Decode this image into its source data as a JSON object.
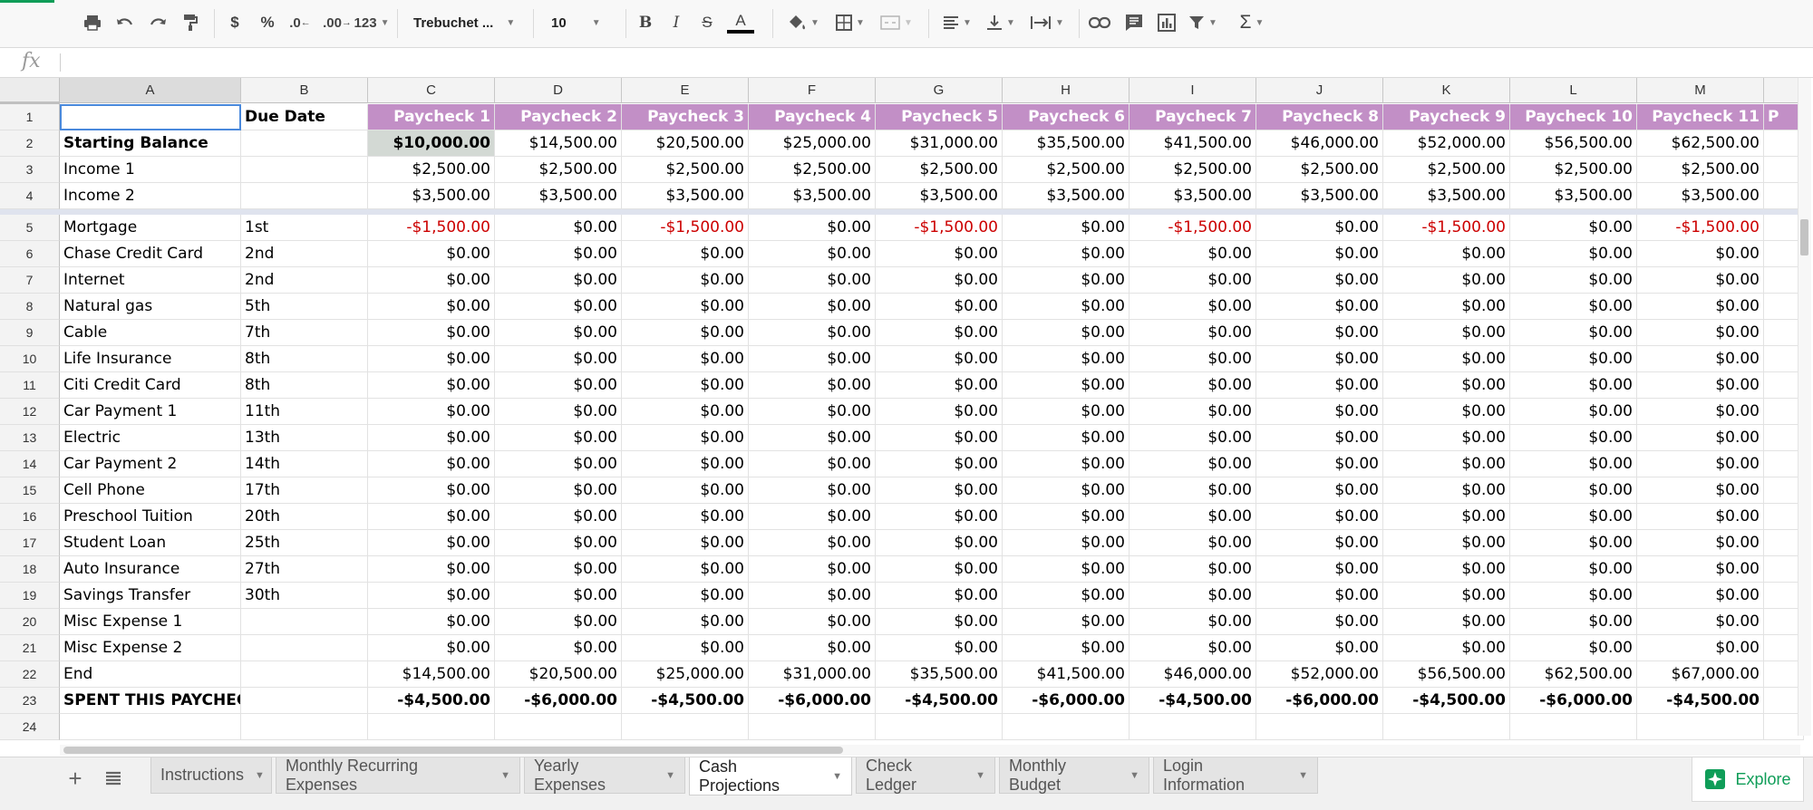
{
  "toolbar": {
    "format_123": "123",
    "font": "Trebuchet ...",
    "font_size": "10",
    "currency": "$",
    "percent": "%",
    "dec_less": ".0",
    "dec_more": ".00",
    "sigma": "Σ"
  },
  "formula_bar": {
    "fx": "fx",
    "value": ""
  },
  "columns": [
    "A",
    "B",
    "C",
    "D",
    "E",
    "F",
    "G",
    "H",
    "I",
    "J",
    "K",
    "L",
    "M"
  ],
  "rows": [
    {
      "n": "1",
      "a": "",
      "b": "Due Date",
      "v": [
        "Paycheck 1",
        "Paycheck 2",
        "Paycheck 3",
        "Paycheck 4",
        "Paycheck 5",
        "Paycheck 6",
        "Paycheck 7",
        "Paycheck 8",
        "Paycheck 9",
        "Paycheck 10",
        "Paycheck 11"
      ],
      "extra": "P"
    },
    {
      "n": "2",
      "a": "Starting Balance",
      "b": "",
      "v": [
        "$10,000.00",
        "$14,500.00",
        "$20,500.00",
        "$25,000.00",
        "$31,000.00",
        "$35,500.00",
        "$41,500.00",
        "$46,000.00",
        "$52,000.00",
        "$56,500.00",
        "$62,500.00"
      ]
    },
    {
      "n": "3",
      "a": "Income 1",
      "b": "",
      "v": [
        "$2,500.00",
        "$2,500.00",
        "$2,500.00",
        "$2,500.00",
        "$2,500.00",
        "$2,500.00",
        "$2,500.00",
        "$2,500.00",
        "$2,500.00",
        "$2,500.00",
        "$2,500.00"
      ]
    },
    {
      "n": "4",
      "a": "Income 2",
      "b": "",
      "v": [
        "$3,500.00",
        "$3,500.00",
        "$3,500.00",
        "$3,500.00",
        "$3,500.00",
        "$3,500.00",
        "$3,500.00",
        "$3,500.00",
        "$3,500.00",
        "$3,500.00",
        "$3,500.00"
      ]
    },
    {
      "n": "5",
      "a": "Mortgage",
      "b": "1st",
      "v": [
        "-$1,500.00",
        "$0.00",
        "-$1,500.00",
        "$0.00",
        "-$1,500.00",
        "$0.00",
        "-$1,500.00",
        "$0.00",
        "-$1,500.00",
        "$0.00",
        "-$1,500.00"
      ]
    },
    {
      "n": "6",
      "a": "Chase Credit Card",
      "b": "2nd",
      "v": [
        "$0.00",
        "$0.00",
        "$0.00",
        "$0.00",
        "$0.00",
        "$0.00",
        "$0.00",
        "$0.00",
        "$0.00",
        "$0.00",
        "$0.00"
      ]
    },
    {
      "n": "7",
      "a": "Internet",
      "b": "2nd",
      "v": [
        "$0.00",
        "$0.00",
        "$0.00",
        "$0.00",
        "$0.00",
        "$0.00",
        "$0.00",
        "$0.00",
        "$0.00",
        "$0.00",
        "$0.00"
      ]
    },
    {
      "n": "8",
      "a": "Natural gas",
      "b": "5th",
      "v": [
        "$0.00",
        "$0.00",
        "$0.00",
        "$0.00",
        "$0.00",
        "$0.00",
        "$0.00",
        "$0.00",
        "$0.00",
        "$0.00",
        "$0.00"
      ]
    },
    {
      "n": "9",
      "a": "Cable",
      "b": "7th",
      "v": [
        "$0.00",
        "$0.00",
        "$0.00",
        "$0.00",
        "$0.00",
        "$0.00",
        "$0.00",
        "$0.00",
        "$0.00",
        "$0.00",
        "$0.00"
      ]
    },
    {
      "n": "10",
      "a": "Life Insurance",
      "b": "8th",
      "v": [
        "$0.00",
        "$0.00",
        "$0.00",
        "$0.00",
        "$0.00",
        "$0.00",
        "$0.00",
        "$0.00",
        "$0.00",
        "$0.00",
        "$0.00"
      ]
    },
    {
      "n": "11",
      "a": "Citi Credit Card",
      "b": "8th",
      "v": [
        "$0.00",
        "$0.00",
        "$0.00",
        "$0.00",
        "$0.00",
        "$0.00",
        "$0.00",
        "$0.00",
        "$0.00",
        "$0.00",
        "$0.00"
      ]
    },
    {
      "n": "12",
      "a": "Car Payment 1",
      "b": "11th",
      "v": [
        "$0.00",
        "$0.00",
        "$0.00",
        "$0.00",
        "$0.00",
        "$0.00",
        "$0.00",
        "$0.00",
        "$0.00",
        "$0.00",
        "$0.00"
      ]
    },
    {
      "n": "13",
      "a": "Electric",
      "b": "13th",
      "v": [
        "$0.00",
        "$0.00",
        "$0.00",
        "$0.00",
        "$0.00",
        "$0.00",
        "$0.00",
        "$0.00",
        "$0.00",
        "$0.00",
        "$0.00"
      ]
    },
    {
      "n": "14",
      "a": "Car Payment 2",
      "b": "14th",
      "v": [
        "$0.00",
        "$0.00",
        "$0.00",
        "$0.00",
        "$0.00",
        "$0.00",
        "$0.00",
        "$0.00",
        "$0.00",
        "$0.00",
        "$0.00"
      ]
    },
    {
      "n": "15",
      "a": "Cell Phone",
      "b": "17th",
      "v": [
        "$0.00",
        "$0.00",
        "$0.00",
        "$0.00",
        "$0.00",
        "$0.00",
        "$0.00",
        "$0.00",
        "$0.00",
        "$0.00",
        "$0.00"
      ]
    },
    {
      "n": "16",
      "a": "Preschool Tuition",
      "b": "20th",
      "v": [
        "$0.00",
        "$0.00",
        "$0.00",
        "$0.00",
        "$0.00",
        "$0.00",
        "$0.00",
        "$0.00",
        "$0.00",
        "$0.00",
        "$0.00"
      ]
    },
    {
      "n": "17",
      "a": "Student Loan",
      "b": "25th",
      "v": [
        "$0.00",
        "$0.00",
        "$0.00",
        "$0.00",
        "$0.00",
        "$0.00",
        "$0.00",
        "$0.00",
        "$0.00",
        "$0.00",
        "$0.00"
      ]
    },
    {
      "n": "18",
      "a": "Auto Insurance",
      "b": "27th",
      "v": [
        "$0.00",
        "$0.00",
        "$0.00",
        "$0.00",
        "$0.00",
        "$0.00",
        "$0.00",
        "$0.00",
        "$0.00",
        "$0.00",
        "$0.00"
      ]
    },
    {
      "n": "19",
      "a": "Savings Transfer",
      "b": "30th",
      "v": [
        "$0.00",
        "$0.00",
        "$0.00",
        "$0.00",
        "$0.00",
        "$0.00",
        "$0.00",
        "$0.00",
        "$0.00",
        "$0.00",
        "$0.00"
      ]
    },
    {
      "n": "20",
      "a": "Misc Expense 1",
      "b": "",
      "v": [
        "$0.00",
        "$0.00",
        "$0.00",
        "$0.00",
        "$0.00",
        "$0.00",
        "$0.00",
        "$0.00",
        "$0.00",
        "$0.00",
        "$0.00"
      ]
    },
    {
      "n": "21",
      "a": "Misc Expense 2",
      "b": "",
      "v": [
        "$0.00",
        "$0.00",
        "$0.00",
        "$0.00",
        "$0.00",
        "$0.00",
        "$0.00",
        "$0.00",
        "$0.00",
        "$0.00",
        "$0.00"
      ]
    },
    {
      "n": "22",
      "a": "End",
      "b": "",
      "v": [
        "$14,500.00",
        "$20,500.00",
        "$25,000.00",
        "$31,000.00",
        "$35,500.00",
        "$41,500.00",
        "$46,000.00",
        "$52,000.00",
        "$56,500.00",
        "$62,500.00",
        "$67,000.00"
      ]
    },
    {
      "n": "23",
      "a": "SPENT THIS PAYCHECK",
      "b": "",
      "v": [
        "-$4,500.00",
        "-$6,000.00",
        "-$4,500.00",
        "-$6,000.00",
        "-$4,500.00",
        "-$6,000.00",
        "-$4,500.00",
        "-$6,000.00",
        "-$4,500.00",
        "-$6,000.00",
        "-$4,500.00"
      ]
    },
    {
      "n": "24",
      "a": "",
      "b": "",
      "v": [
        "",
        "",
        "",
        "",
        "",
        "",
        "",
        "",
        "",
        "",
        ""
      ]
    }
  ],
  "sheet_tabs": [
    {
      "label": "Instructions",
      "active": false
    },
    {
      "label": "Monthly Recurring Expenses",
      "active": false
    },
    {
      "label": "Yearly Expenses",
      "active": false
    },
    {
      "label": "Cash Projections",
      "active": true
    },
    {
      "label": "Check Ledger",
      "active": false
    },
    {
      "label": "Monthly Budget",
      "active": false
    },
    {
      "label": "Login Information",
      "active": false
    }
  ],
  "explore_label": "Explore",
  "colors": {
    "header_fill": "#c28fc6",
    "negative": "#cc0000",
    "explore": "#0f9d58"
  }
}
